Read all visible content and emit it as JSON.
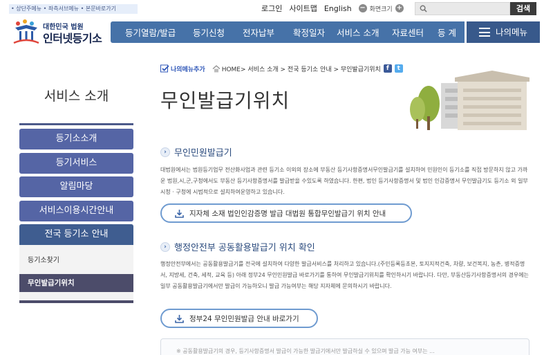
{
  "top": {
    "skip_links": "• 상단주메뉴 • 좌측서브메뉴 • 본문바로가기",
    "login": "로그인",
    "sitemap": "사이트맵",
    "english": "English",
    "zoom_minus": "−",
    "zoom_label": "화면크기",
    "zoom_plus": "+",
    "search_placeholder": "",
    "search_button": "검색"
  },
  "logo": {
    "sub": "대한민국 법원",
    "main": "인터넷등기소"
  },
  "gnb": {
    "items": [
      "등기열람/발급",
      "등기신청",
      "전자납부",
      "확정일자",
      "서비스 소개",
      "자료센터",
      "등 계"
    ],
    "my_menu": "나의메뉴"
  },
  "sidebar": {
    "title": "서비스 소개",
    "items": [
      "등기소소개",
      "등기서비스",
      "알림마당",
      "서비스이용시간안내",
      "전국 등기소 안내"
    ],
    "subitems": [
      "등기소찾기",
      "무인발급기위치"
    ]
  },
  "breadcrumb": {
    "add_my_menu": "나의메뉴추가",
    "path": "HOME> 서비스 소개 > 전국 등기소 안내 > 무인발급기위치"
  },
  "page": {
    "title": "무인발급기위치"
  },
  "sections": [
    {
      "heading": "무인민원발급기",
      "body": "대법원에서는 법원등기업무 전산화사업과 관련 등기소 이외의 장소에 부동산 등기사항증명서무인발급기를 설치하여 민원인이 등기소를 직접 방문하지 않고 가까운 법원,시,군,구청에서도 부동산 등기사항증명서를 발급받을 수있도록 하였습니다. 한편, 법인 등기사항증명서 및 법인 인감증명서 무인발급기도 등기소 외 일부 시청 · 구청에 시범적으로 설치하여운영하고 있습니다.",
      "button": "지자체 소재 법인인감증명 발급 대법원 통합무인발급기 위치 안내"
    },
    {
      "heading": "행정안전부 공동활용발급기 위치 확인",
      "body": "행정안전부에서는 공동활용발급기를 전국에 설치하여 다양한 발급서비스를 처리하고 있습니다.(주민등록등초본, 토지지적건축, 차량, 보건복지, 농촌, 병적증명서, 지방세, 건축, 세적, 교육 등) 아래 정부24 무인민원발급 바로가기를 통하여 무인발급기위치를 확인하시기 바랍니다. 다만, 부동산등기사항증명서의 경우에는 일부 공동활용발급기에서만 발급이 가능하오니 발급 가능여부는 해당 지자체에 문의하시기 바랍니다.",
      "button": "정부24 무인민원발급 안내 바로가기"
    }
  ],
  "bottom_box_text": "※ 공동활용발급기의 경우, 등기사항증명서 발급이 가능한 발급기에서만 발급하실 수 있으며 발급 가능 여부는 ..."
}
